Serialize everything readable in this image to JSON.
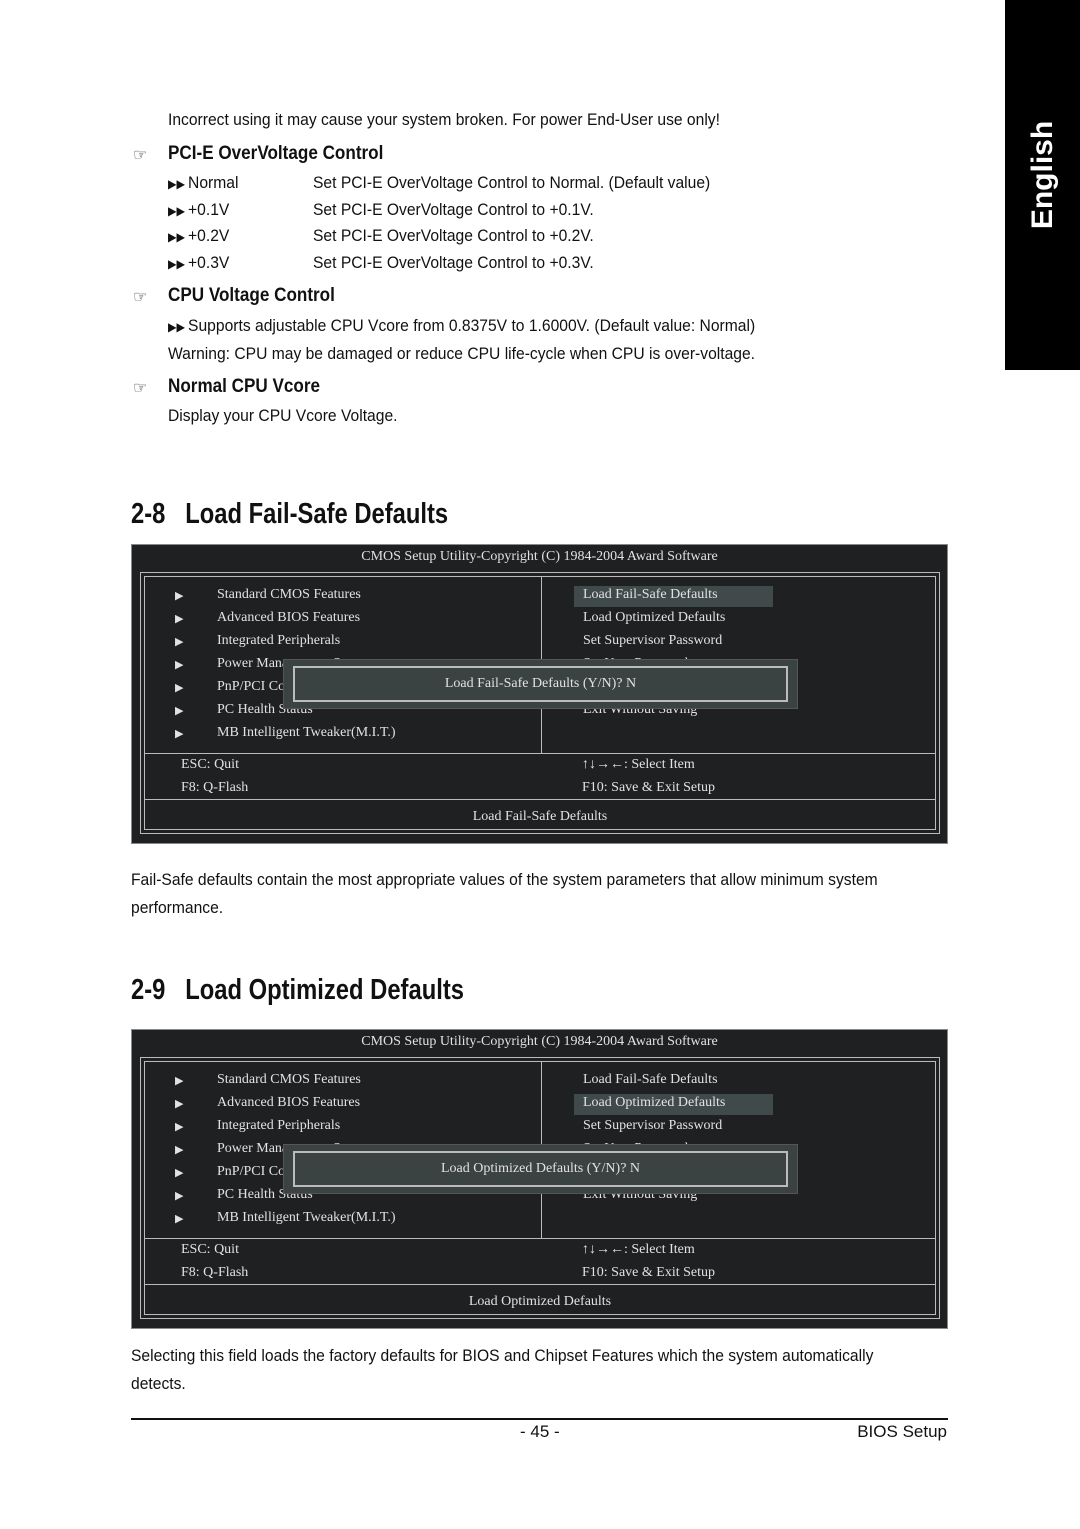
{
  "side_tab": "English",
  "intro_line": "Incorrect using it may cause your system broken. For power End-User use only!",
  "pcie": {
    "title": "PCI-E OverVoltage Control",
    "options": [
      {
        "name": "Normal",
        "desc": "Set PCI-E OverVoltage Control to Normal. (Default value)"
      },
      {
        "name": "+0.1V",
        "desc": "Set PCI-E OverVoltage Control to +0.1V."
      },
      {
        "name": "+0.2V",
        "desc": "Set PCI-E OverVoltage Control to +0.2V."
      },
      {
        "name": "+0.3V",
        "desc": "Set PCI-E OverVoltage Control to +0.3V."
      }
    ]
  },
  "cpu_voltage": {
    "title": "CPU Voltage Control",
    "line1": "Supports adjustable CPU Vcore from 0.8375V to 1.6000V. (Default value: Normal)",
    "line2": "Warning: CPU may be damaged or reduce CPU life-cycle when CPU is over-voltage."
  },
  "normal_vcore": {
    "title": "Normal CPU Vcore",
    "desc": "Display your CPU Vcore Voltage."
  },
  "s28": {
    "num": "2-8",
    "title": "Load Fail-Safe Defaults",
    "para1": "Fail-Safe defaults contain the most appropriate values of the system parameters that allow minimum system",
    "para2": "performance."
  },
  "s29": {
    "num": "2-9",
    "title": "Load Optimized Defaults",
    "para1": "Selecting this field loads the factory defaults for BIOS and Chipset Features which the system automatically",
    "para2": "detects."
  },
  "bios": [
    {
      "title": "CMOS Setup Utility-Copyright (C) 1984-2004 Award Software",
      "left": [
        "Standard CMOS Features",
        "Advanced BIOS Features",
        "Integrated Peripherals",
        "Power Management Setup",
        "PnP/PCI Configurations",
        "PC Health Status",
        "MB Intelligent Tweaker(M.I.T.)"
      ],
      "right": [
        "Load Fail-Safe Defaults",
        "Load Optimized Defaults",
        "Set Supervisor Password",
        "Set User Password",
        "Save & Exit Setup",
        "Exit Without Saving"
      ],
      "selected": 0,
      "dialog": "Load Fail-Safe Defaults (Y/N)? N",
      "keys": {
        "esc": "ESC: Quit",
        "f8": "F8: Q-Flash",
        "arrows": "↑↓→←: Select Item",
        "f10": "F10: Save & Exit Setup"
      },
      "status": "Load Fail-Safe Defaults"
    },
    {
      "title": "CMOS Setup Utility-Copyright (C) 1984-2004 Award Software",
      "left": [
        "Standard CMOS Features",
        "Advanced BIOS Features",
        "Integrated Peripherals",
        "Power Management Setup",
        "PnP/PCI Configurations",
        "PC Health Status",
        "MB Intelligent Tweaker(M.I.T.)"
      ],
      "right": [
        "Load Fail-Safe Defaults",
        "Load Optimized Defaults",
        "Set Supervisor Password",
        "Set User Password",
        "Save & Exit Setup",
        "Exit Without Saving"
      ],
      "selected": 1,
      "dialog": "Load Optimized Defaults (Y/N)? N",
      "keys": {
        "esc": "ESC: Quit",
        "f8": "F8: Q-Flash",
        "arrows": "↑↓→←: Select Item",
        "f10": "F10: Save & Exit Setup"
      },
      "status": "Load Optimized Defaults"
    }
  ],
  "footer": {
    "page": "- 45 -",
    "section": "BIOS Setup"
  }
}
